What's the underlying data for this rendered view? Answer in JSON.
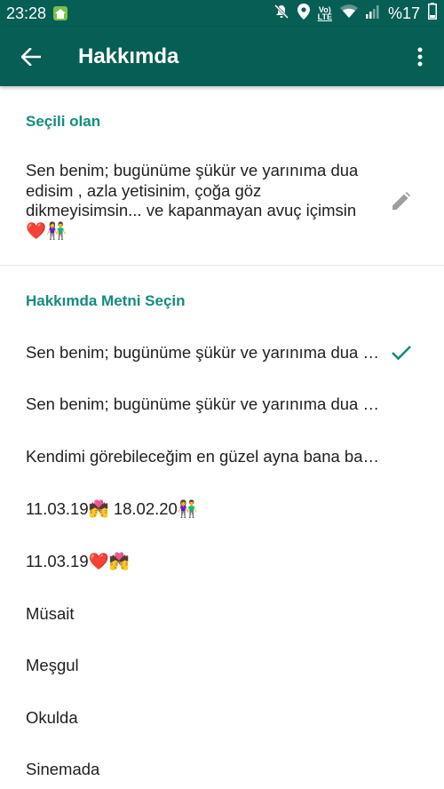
{
  "status_bar": {
    "time": "23:28",
    "volte_top": "Vo)",
    "volte_bottom": "LTE",
    "battery_text": "%17",
    "icons": [
      "home-app-icon",
      "mute-icon",
      "location-icon",
      "volte-icon",
      "wifi-icon",
      "signal-icon"
    ]
  },
  "app_bar": {
    "title": "Hakkımda",
    "icons": [
      "back-arrow-icon",
      "more-vert-icon"
    ]
  },
  "current_section": {
    "header": "Seçili olan",
    "text": "Sen benim; bugünüme şükür ve yarınıma dua edisim , azla yetisinim, çoğa göz dikmeyisimsin... ve kapanmayan avuç içimsin ❤️👫",
    "edit_icon": "pencil-icon"
  },
  "options_section": {
    "header": "Hakkımda Metni Seçin",
    "selected_icon": "checkmark-icon",
    "options": [
      "Sen benim; bugünüme şükür ve yarınıma dua edisim",
      "Sen benim; bugünüme şükür ve yarınıma dua edisim",
      "Kendimi görebileceğim en güzel ayna bana bakan gözlerin",
      "11.03.19💏 18.02.20👫",
      "11.03.19❤️💏",
      "Müsait",
      "Meşgul",
      "Okulda",
      "Sinemada"
    ]
  },
  "colors": {
    "toolbar": "#075e54",
    "accent": "#128c7e",
    "text": "#1f1f1f",
    "icon_gray": "#9e9e9e"
  }
}
